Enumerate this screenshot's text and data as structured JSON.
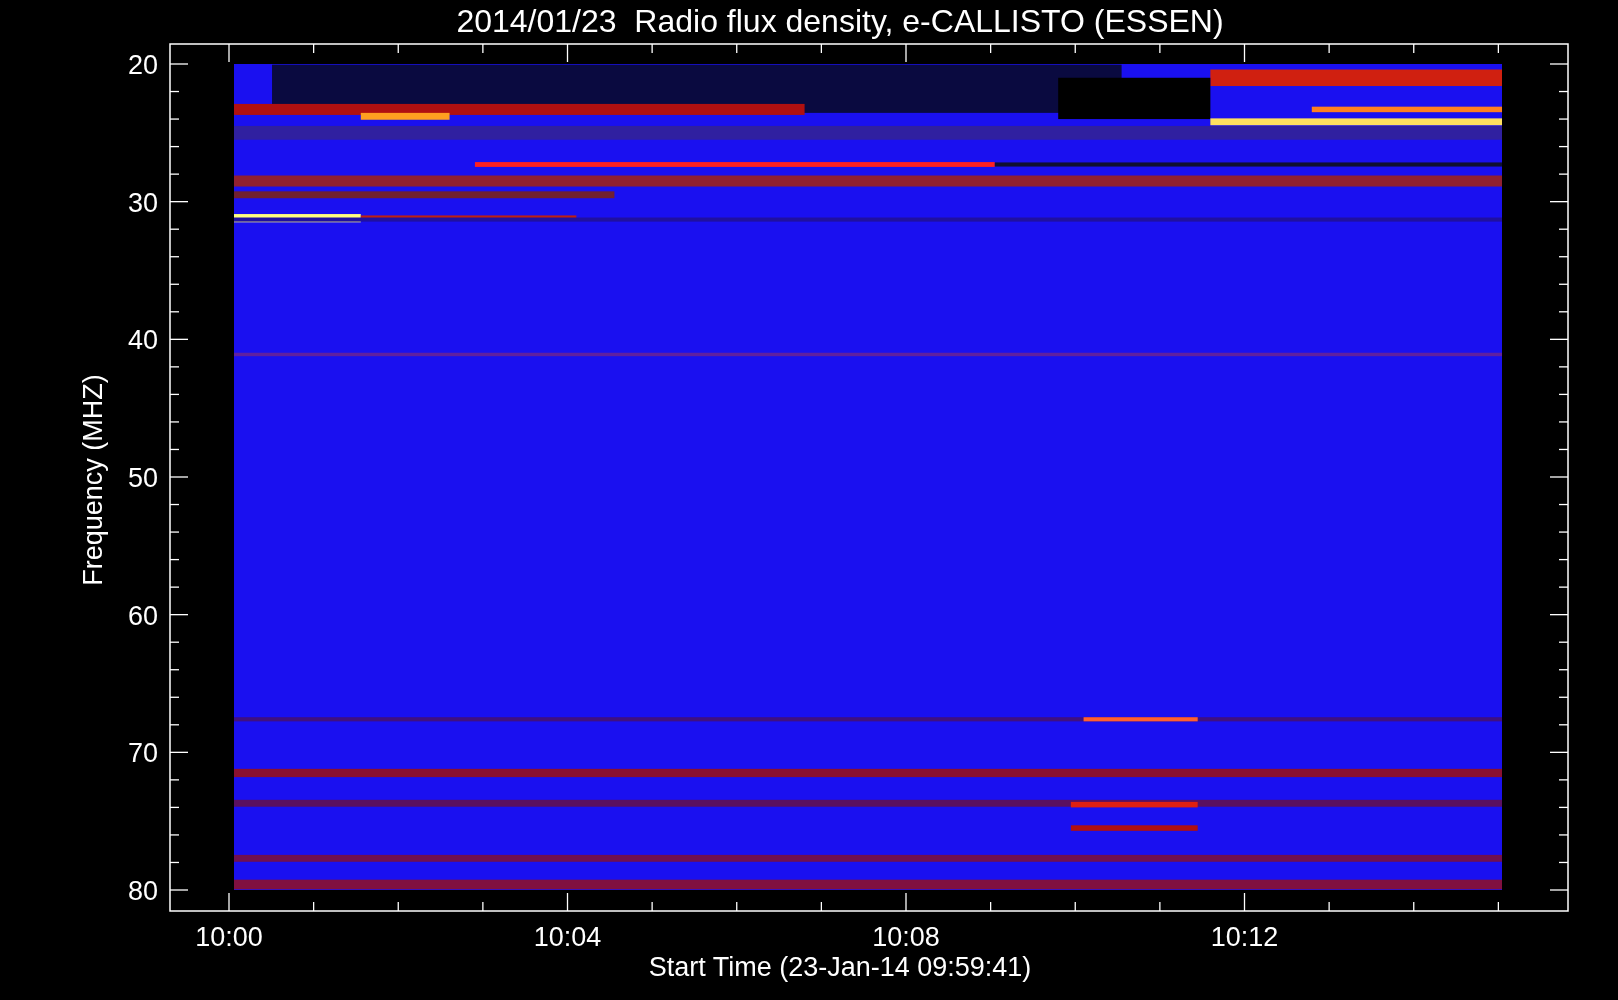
{
  "title": "2014/01/23  Radio flux density, e-CALLISTO (ESSEN)",
  "y_axis": {
    "label": "Frequency (MHZ)",
    "ticks": [
      "20",
      "30",
      "40",
      "50",
      "60",
      "70",
      "80"
    ]
  },
  "x_axis": {
    "label": "Start Time (23-Jan-14 09:59:41)",
    "ticks": [
      "10:00",
      "10:04",
      "10:08",
      "10:12"
    ]
  }
}
